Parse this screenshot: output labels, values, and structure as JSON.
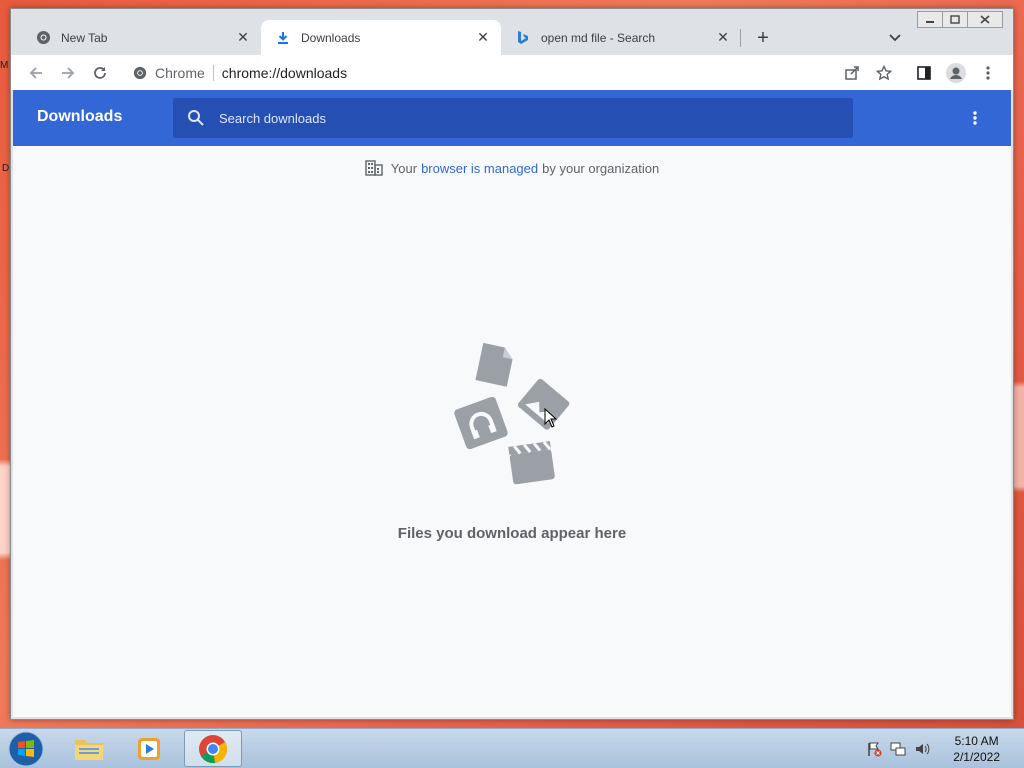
{
  "desktop": {
    "edge_letter_1": "M",
    "edge_letter_2": "D"
  },
  "tabs": [
    {
      "label": "New Tab",
      "icon": "chrome-icon",
      "active": false
    },
    {
      "label": "Downloads",
      "icon": "download-icon",
      "active": true
    },
    {
      "label": "open md file - Search",
      "icon": "bing-icon",
      "active": false
    }
  ],
  "toolbar": {
    "site_chip": "Chrome",
    "url": "chrome://downloads"
  },
  "downloads": {
    "title": "Downloads",
    "search_placeholder": "Search downloads",
    "managed_prefix": "Your",
    "managed_link": "browser is managed",
    "managed_suffix": "by your organization",
    "empty_message": "Files you download appear here"
  },
  "taskbar": {
    "time": "5:10 AM",
    "date": "2/1/2022"
  },
  "colors": {
    "header_blue": "#3367d6",
    "search_blue": "#254fb3",
    "page_bg": "#f8f9fa"
  }
}
